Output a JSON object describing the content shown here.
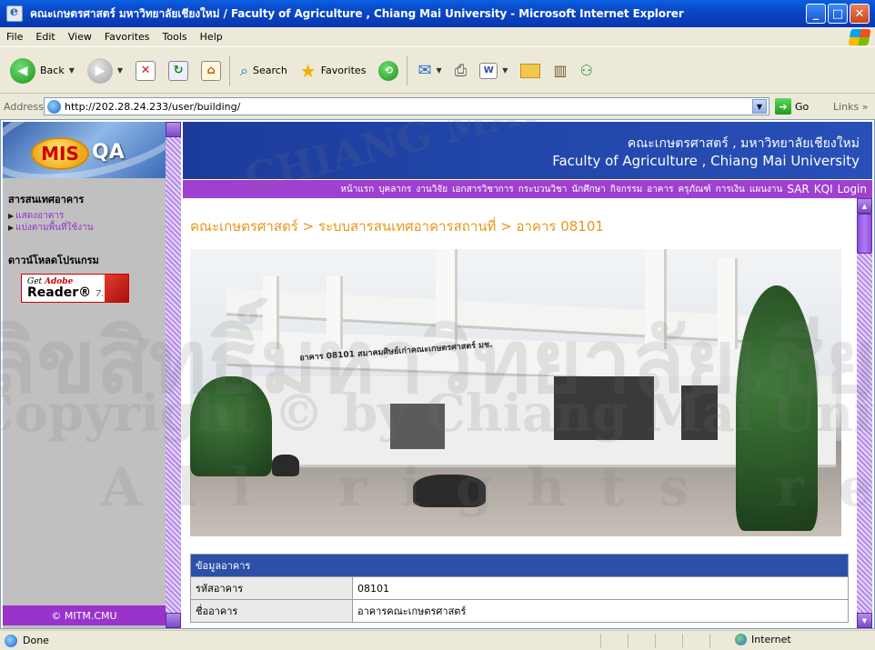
{
  "window": {
    "title": "คณะเกษตรศาสตร์ มหาวิทยาลัยเชียงใหม่ / Faculty of Agriculture , Chiang Mai University   - Microsoft Internet Explorer"
  },
  "menu": [
    "File",
    "Edit",
    "View",
    "Favorites",
    "Tools",
    "Help"
  ],
  "toolbar": {
    "back": "Back",
    "search": "Search",
    "favorites": "Favorites"
  },
  "address": {
    "label": "Address",
    "url": "http://202.28.24.233/user/building/",
    "go": "Go",
    "links": "Links"
  },
  "sidebar": {
    "logo_mis": "MIS",
    "logo_qa": "QA",
    "section1": "สารสนเทศอาคาร",
    "links": [
      "แสดงอาคาร",
      "แบ่งตามพื้นที่ใช้งาน"
    ],
    "section2": "ดาวน์โหลดโปรแกรม",
    "adobe_get": "Get",
    "adobe_brand": "Adobe",
    "adobe_reader": "Reader",
    "adobe_version": "7.0",
    "copyright": "© MITM.CMU"
  },
  "header": {
    "th": "คณะเกษตรศาสตร์ , มหาวิทยาลัยเชียงใหม่",
    "en": "Faculty of Agriculture , Chiang Mai University"
  },
  "nav": [
    "หน้าแรก",
    "บุคลากร",
    "งานวิจัย",
    "เอกสารวิชาการ",
    "กระบวนวิชา",
    "นักศึกษา",
    "กิจกรรม",
    "อาคาร",
    "ครุภัณฑ์",
    "การเงิน",
    "แผนงาน",
    "SAR",
    "KQI",
    "Login"
  ],
  "breadcrumb": "คณะเกษตรศาสตร์ > ระบบสารสนเทศอาคารสถานที่ > อาคาร 08101",
  "photo": {
    "sign_text": "อาคาร 08101   สมาคมศิษย์เก่าคณะเกษตรศาสตร์ มช."
  },
  "info_table": {
    "header": "ข้อมูลอาคาร",
    "rows": [
      {
        "label": "รหัสอาคาร",
        "value": "08101"
      },
      {
        "label": "ชื่ออาคาร",
        "value": "อาคารคณะเกษตรศาสตร์"
      }
    ]
  },
  "status": {
    "text": "Done",
    "zone": "Internet"
  },
  "watermark": {
    "line1": "Copyright © by Chiang Mai University",
    "line2": "All rights reserved",
    "line3": "ลิขสิทธิ์มหาวิทยาลัยเชียงใหม่",
    "line4": "CHIANG MAI UNIVERSITY"
  }
}
